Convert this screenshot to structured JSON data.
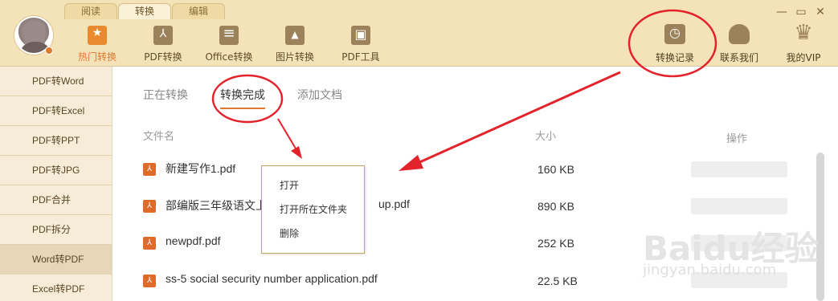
{
  "tabs": [
    "阅读",
    "转换",
    "编辑"
  ],
  "active_tab": "转换",
  "tools": [
    {
      "label": "热门转换",
      "icon": "star-icon"
    },
    {
      "label": "PDF转换",
      "icon": "pdf-icon"
    },
    {
      "label": "Office转换",
      "icon": "office-icon"
    },
    {
      "label": "图片转换",
      "icon": "image-icon"
    },
    {
      "label": "PDF工具",
      "icon": "toolbox-icon"
    }
  ],
  "right_tools": [
    {
      "label": "转换记录",
      "icon": "clock-icon"
    },
    {
      "label": "联系我们",
      "icon": "headset-icon"
    },
    {
      "label": "我的VIP",
      "icon": "crown-icon"
    }
  ],
  "window_buttons": [
    "—",
    "▭",
    "✕"
  ],
  "sidebar": {
    "items": [
      "PDF转Word",
      "PDF转Excel",
      "PDF转PPT",
      "PDF转JPG",
      "PDF合并",
      "PDF拆分",
      "Word转PDF",
      "Excel转PDF"
    ],
    "active": "Word转PDF"
  },
  "subtabs": [
    "正在转换",
    "转换完成",
    "添加文档"
  ],
  "active_subtab": "转换完成",
  "table": {
    "headers": {
      "name": "文件名",
      "size": "大小",
      "action": "操作"
    },
    "rows": [
      {
        "name": "新建写作1.pdf",
        "size": "160 KB"
      },
      {
        "name": "部编版三年级语文上",
        "name_tail": "up.pdf",
        "size": "890 KB"
      },
      {
        "name": "newpdf.pdf",
        "size": "252 KB"
      },
      {
        "name": "ss-5 social security number application.pdf",
        "size": "22.5 KB"
      }
    ]
  },
  "context_menu": {
    "items": [
      "打开",
      "打开所在文件夹",
      "删除"
    ]
  },
  "watermark": {
    "main": "Baidu经验",
    "sub": "jingyan.baidu.com"
  },
  "colors": {
    "accent": "#e07a2e",
    "annotation": "#e3232c",
    "topbar": "#f4e3b8"
  }
}
